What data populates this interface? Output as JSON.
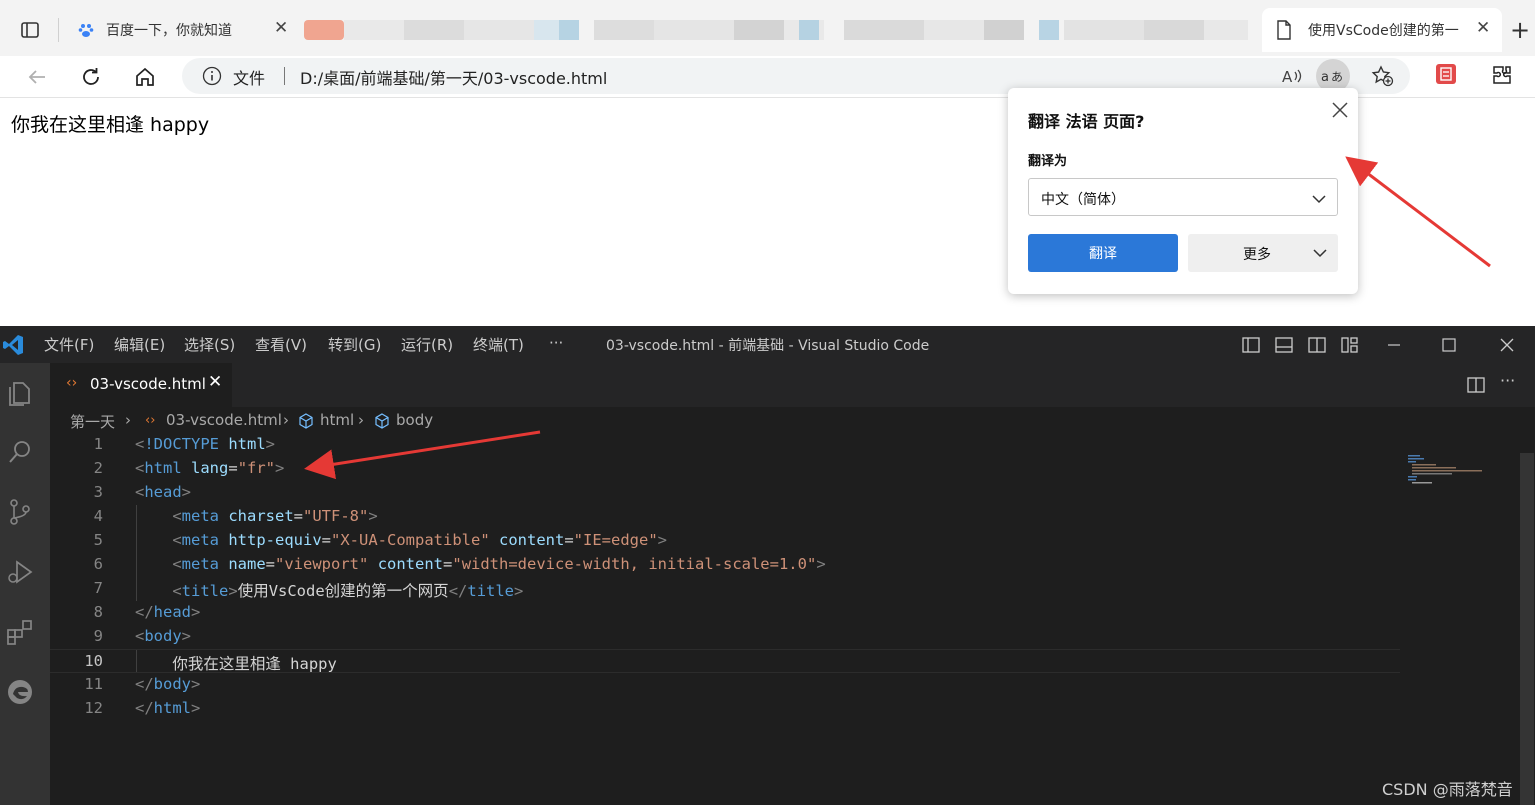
{
  "browser": {
    "tabs": [
      {
        "title": "百度一下，你就知道",
        "active": false
      },
      {
        "title": "使用VsCode创建的第一",
        "active": true
      }
    ],
    "address": {
      "scheme_label": "文件",
      "url": "D:/桌面/前端基础/第一天/03-vscode.html"
    },
    "toolbar_icons": [
      "back-icon",
      "refresh-icon",
      "home-icon",
      "info-icon",
      "read-aloud-icon",
      "translate-icon",
      "favorites-add-icon",
      "extension-red-icon",
      "extensions-icon"
    ]
  },
  "page": {
    "body_text": "你我在这里相逢 happy"
  },
  "translate_popup": {
    "title": "翻译 法语 页面?",
    "label": "翻译为",
    "selected_language": "中文（简体）",
    "translate_button": "翻译",
    "more_button": "更多"
  },
  "vscode": {
    "menu": [
      "文件(F)",
      "编辑(E)",
      "选择(S)",
      "查看(V)",
      "转到(G)",
      "运行(R)",
      "终端(T)",
      "···"
    ],
    "window_title": "03-vscode.html - 前端基础 - Visual Studio Code",
    "tab": {
      "label": "03-vscode.html"
    },
    "breadcrumb": [
      "第一天",
      "03-vscode.html",
      "html",
      "body"
    ],
    "current_line": 10,
    "code_lines": [
      {
        "n": "1"
      },
      {
        "n": "2"
      },
      {
        "n": "3"
      },
      {
        "n": "4"
      },
      {
        "n": "5"
      },
      {
        "n": "6"
      },
      {
        "n": "7"
      },
      {
        "n": "8"
      },
      {
        "n": "9"
      },
      {
        "n": "10"
      },
      {
        "n": "11"
      },
      {
        "n": "12"
      }
    ],
    "code": {
      "doctype_kw": "!DOCTYPE",
      "doctype_val": "html",
      "html_tag": "html",
      "lang_attr": "lang",
      "lang_val": "\"fr\"",
      "head_tag": "head",
      "meta_tag": "meta",
      "charset_attr": "charset",
      "charset_val": "\"UTF-8\"",
      "httpequiv_attr": "http-equiv",
      "httpequiv_val": "\"X-UA-Compatible\"",
      "content_attr": "content",
      "ie_val": "\"IE=edge\"",
      "name_attr": "name",
      "viewport_val": "\"viewport\"",
      "viewport_content_val": "\"width=device-width, initial-scale=1.0\"",
      "title_tag": "title",
      "title_text": "使用VsCode创建的第一个网页",
      "body_tag": "body",
      "body_text": "你我在这里相逢 happy"
    }
  },
  "watermark": "CSDN @雨落梵音",
  "colors": {
    "accent_blue": "#2b78d8",
    "annotation_red": "#e53935",
    "vscode_bg": "#1e1e1e"
  }
}
